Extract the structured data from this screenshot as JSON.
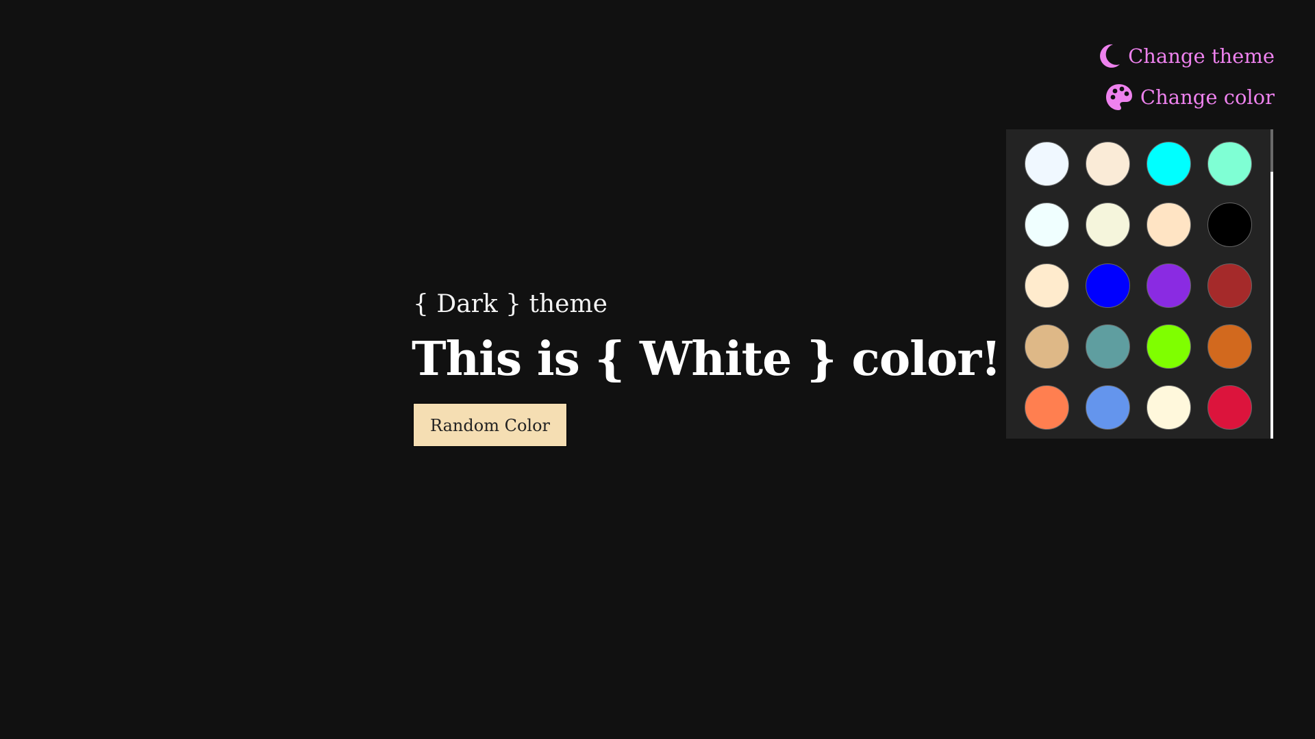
{
  "controls": {
    "theme_label": "Change theme",
    "color_label": "Change color",
    "accent": "#ee82ee"
  },
  "main": {
    "subtitle": "{ Dark } theme",
    "headline": "This is { White } color!",
    "button_label": "Random Color",
    "button_color": "#f5deb3"
  },
  "palette": {
    "swatches": [
      "#f0f8ff",
      "#faebd7",
      "#00ffff",
      "#7fffd4",
      "#f0ffff",
      "#f5f5dc",
      "#ffe4c4",
      "#000000",
      "#ffebcd",
      "#0000ff",
      "#8a2be2",
      "#a52a2a",
      "#deb887",
      "#5f9ea0",
      "#7fff00",
      "#d2691e",
      "#ff7f50",
      "#6495ed",
      "#fff8dc",
      "#dc143c"
    ]
  }
}
